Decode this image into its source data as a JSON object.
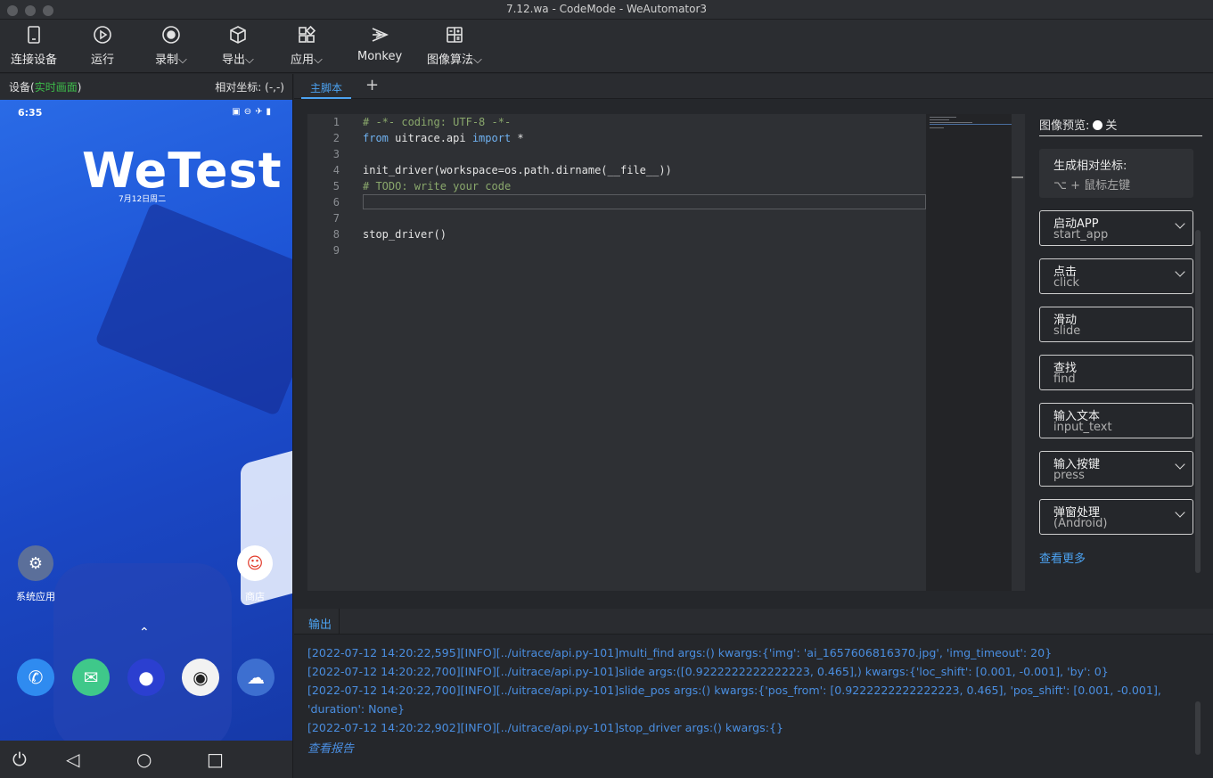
{
  "window": {
    "title": "7.12.wa - CodeMode - WeAutomator3"
  },
  "toolbar": {
    "connect": "连接设备",
    "run": "运行",
    "record": "录制",
    "export": "导出",
    "apply": "应用",
    "monkey": "Monkey",
    "image_algo": "图像算法"
  },
  "device": {
    "label_prefix": "设备(",
    "label_live": "实时画面",
    "label_suffix": ")",
    "coords": "相对坐标: (-,-)",
    "phone": {
      "time": "6:35",
      "brand": "WeTest",
      "date": "7月12日周二",
      "system_apps": "系统应用",
      "store": "商店"
    }
  },
  "editor": {
    "tab": "主脚本",
    "add_tab": "+",
    "lines": [
      "1",
      "2",
      "3",
      "4",
      "5",
      "6",
      "7",
      "8",
      "9"
    ],
    "code": {
      "l1": "# -*- coding: UTF-8 -*-",
      "l2_kw1": "from",
      "l2_mod": " uitrace.api ",
      "l2_kw2": "import",
      "l2_rest": " *",
      "l4": "init_driver(workspace=os.path.dirname(__file__))",
      "l5": "# TODO: write your code",
      "l8": "stop_driver()"
    }
  },
  "right_panel": {
    "preview_label": "图像预览:",
    "preview_state": "关",
    "coord_title": "生成相对坐标:",
    "coord_hint": "⌥ + 鼠标左键",
    "functions": [
      {
        "zh": "启动APP",
        "en": "start_app"
      },
      {
        "zh": "点击",
        "en": "click"
      },
      {
        "zh": "滑动",
        "en": "slide"
      },
      {
        "zh": "查找",
        "en": "find"
      },
      {
        "zh": "输入文本",
        "en": "input_text"
      },
      {
        "zh": "输入按键",
        "en": "press"
      },
      {
        "zh": "弹窗处理",
        "en": "(Android)"
      }
    ],
    "more": "查看更多"
  },
  "output": {
    "tab": "输出",
    "logs": [
      "[2022-07-12 14:20:22,595][INFO][../uitrace/api.py-101]multi_find args:() kwargs:{'img': 'ai_1657606816370.jpg', 'img_timeout': 20}",
      "[2022-07-12 14:20:22,700][INFO][../uitrace/api.py-101]slide args:([0.9222222222222223, 0.465],) kwargs:{'loc_shift': [0.001, -0.001], 'by': 0}",
      "[2022-07-12 14:20:22,700][INFO][../uitrace/api.py-101]slide_pos args:() kwargs:{'pos_from': [0.9222222222222223, 0.465], 'pos_shift': [0.001, -0.001],",
      "'duration': None}",
      "[2022-07-12 14:20:22,902][INFO][../uitrace/api.py-101]stop_driver args:() kwargs:{}"
    ],
    "report": "查看报告"
  }
}
